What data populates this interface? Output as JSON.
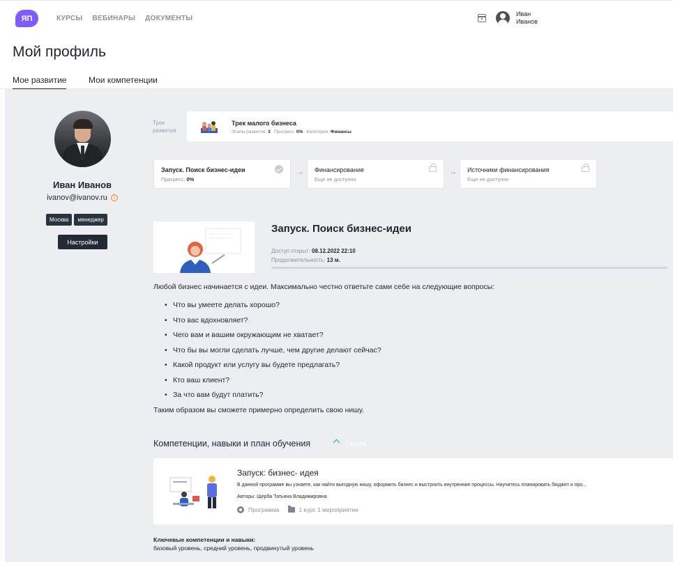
{
  "header": {
    "logo": "ЯП",
    "nav": [
      "КУРСЫ",
      "ВЕБИНАРЫ",
      "ДОКУМЕНТЫ"
    ],
    "user": {
      "first_name": "Иван",
      "last_name": "Иванов"
    }
  },
  "page_title": "Мой профиль",
  "tabs": [
    {
      "label": "Мое развитие",
      "active": true
    },
    {
      "label": "Мои компетенции",
      "active": false
    }
  ],
  "profile": {
    "name": "Иван Иванов",
    "email": "ivanov@ivanov.ru",
    "tags": [
      "Москва",
      "менеджер"
    ],
    "settings_label": "Настройки"
  },
  "track": {
    "label_line1": "Трек",
    "label_line2": "развития",
    "title": "Трек малого бизнеса",
    "stages_label": "Этапы развития:",
    "stages_value": "3",
    "progress_label": "Прогресс:",
    "progress_value": "0%",
    "category_label": "Категории:",
    "category_value": "Финансы"
  },
  "stages": [
    {
      "title": "Запуск. Поиск бизнес-идеи",
      "sub_label": "Прогресс:",
      "sub_value": "0%",
      "status": "active"
    },
    {
      "title": "Финансирование",
      "sub_label": "Еще не доступно",
      "sub_value": "",
      "status": "locked"
    },
    {
      "title": "Источники финансирования",
      "sub_label": "Еще не доступно",
      "sub_value": "",
      "status": "locked"
    }
  ],
  "lesson": {
    "title": "Запуск. Поиск бизнес-идеи",
    "access_label": "Доступ открыт:",
    "access_value": "08.12.2022 22:10",
    "duration_label": "Продолжительность:",
    "duration_value": "13 м.",
    "progress": 0
  },
  "body": {
    "intro": "Любой бизнес начинается с идеи. Максимально честно ответьте сами себе на следующие вопросы:",
    "questions": [
      "Что вы умеете делать хорошо?",
      "Что вас вдохновляет?",
      "Чего вам и вашим окружающим не хватает?",
      "Что бы вы могли сделать лучше, чем другие делают сейчас?",
      "Какой продукт или услугу вы будете предлагать?",
      "Кто ваш клиент?",
      "За что вам будут платить?"
    ],
    "outro": "Таким образом вы сможете примерно определить свою нишу."
  },
  "competencies": {
    "heading": "Компетенции, навыки и план обучения",
    "toggle": "Скрыть",
    "course": {
      "title": "Запуск: бизнес- идея",
      "description": "В данной программе вы узнаете, как найти выгодную нишу, оформить бизнес и выстроить внутренние процессы. Научитесь планировать бюджет и про...",
      "authors": "Авторы: Щерба Татьяна Владимировна",
      "type": "Программа",
      "count": "1 курс 1 мероприятие"
    },
    "key_title": "Ключевые компетенции и навыки:",
    "key_values": "базовый уровень, средний уровень, продвинутый уровень"
  },
  "colors": {
    "accent": "#7c5cff",
    "success": "#22b35e",
    "warning": "#ff7a1a",
    "dark": "#232a36"
  }
}
